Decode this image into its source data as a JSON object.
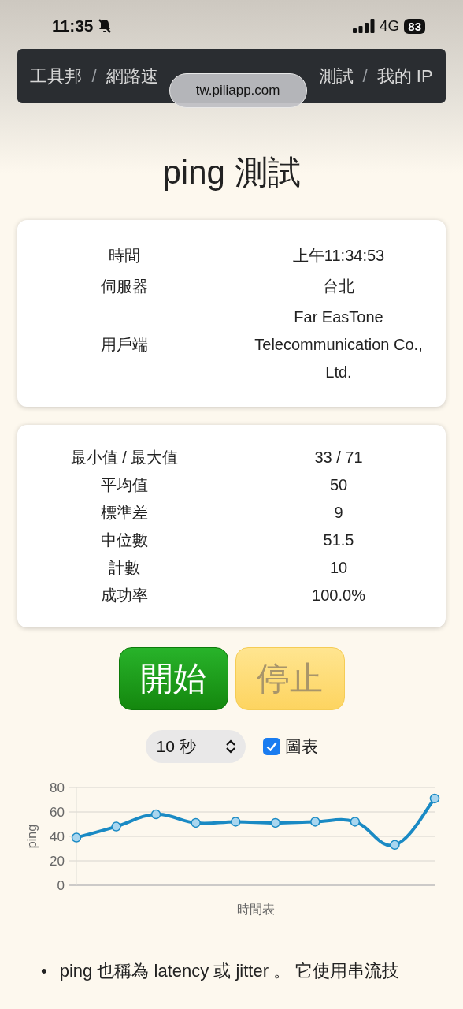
{
  "status_bar": {
    "time": "11:35",
    "network": "4G",
    "battery": "83"
  },
  "breadcrumb": [
    {
      "kind": "link",
      "label": "工具邦"
    },
    {
      "kind": "separator",
      "label": "/"
    },
    {
      "kind": "link",
      "label": "網路速"
    },
    {
      "kind": "covered"
    },
    {
      "kind": "link",
      "label": "測試"
    },
    {
      "kind": "separator",
      "label": "/"
    },
    {
      "kind": "link",
      "label": "我的 IP"
    }
  ],
  "url_pill": "tw.piliapp.com",
  "title": "ping 測試",
  "info_card": [
    {
      "label": "時間",
      "value": "上午11:34:53"
    },
    {
      "label": "伺服器",
      "value": "台北"
    },
    {
      "label": "用戶端",
      "value": "Far EasTone Telecommunication Co., Ltd."
    }
  ],
  "stats_card": [
    {
      "label": "最小值 / 最大值",
      "value": "33 / 71"
    },
    {
      "label": "平均值",
      "value": "50"
    },
    {
      "label": "標準差",
      "value": "9"
    },
    {
      "label": "中位數",
      "value": "51.5"
    },
    {
      "label": "計數",
      "value": "10"
    },
    {
      "label": "成功率",
      "value": "100.0%"
    }
  ],
  "buttons": [
    {
      "label": "開始",
      "kind": "start",
      "disabled": false
    },
    {
      "label": "停止",
      "kind": "stop",
      "disabled": true
    }
  ],
  "interval_select": {
    "value": "10 秒"
  },
  "chart_toggle": {
    "label": "圖表",
    "checked": true
  },
  "chart_data": {
    "type": "line",
    "xlabel": "時間表",
    "ylabel": "ping",
    "ylim": [
      0,
      80
    ],
    "yticks": [
      0,
      20,
      40,
      60,
      80
    ],
    "grid": true,
    "series": [
      {
        "color": "#1a8ac4",
        "marker": true,
        "values": [
          39,
          48,
          58,
          51,
          52,
          51,
          52,
          52,
          33,
          71
        ]
      }
    ]
  },
  "bullets": [
    {
      "marker": "•",
      "text": "ping 也稱為 latency 或 jitter 。 它使用串流技"
    }
  ]
}
